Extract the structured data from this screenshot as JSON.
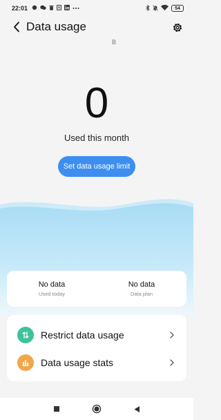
{
  "status_bar": {
    "time": "22:01",
    "notification_icons": [
      "chat-bubble-icon",
      "message-icon",
      "trash-icon",
      "clipboard-icon",
      "linkedin-icon",
      "more-dots-icon"
    ],
    "system_icons": [
      "bluetooth-icon",
      "mute-icon",
      "wifi-icon"
    ],
    "battery_level": "54"
  },
  "header": {
    "title": "Data usage"
  },
  "usage": {
    "value": "0",
    "unit": "B",
    "caption": "Used this month",
    "limit_button": "Set data usage limit"
  },
  "summary": [
    {
      "value": "No data",
      "label": "Used today"
    },
    {
      "value": "No data",
      "label": "Data plan"
    }
  ],
  "actions": [
    {
      "label": "Restrict data usage",
      "icon": "restrict-arrows-icon",
      "color": "#3ec29b"
    },
    {
      "label": "Data usage stats",
      "icon": "bar-chart-icon",
      "color": "#f2a64a"
    }
  ],
  "colors": {
    "accent": "#3e8ef0",
    "background": "#f4f4f4",
    "wave": "#b8e3f7"
  }
}
